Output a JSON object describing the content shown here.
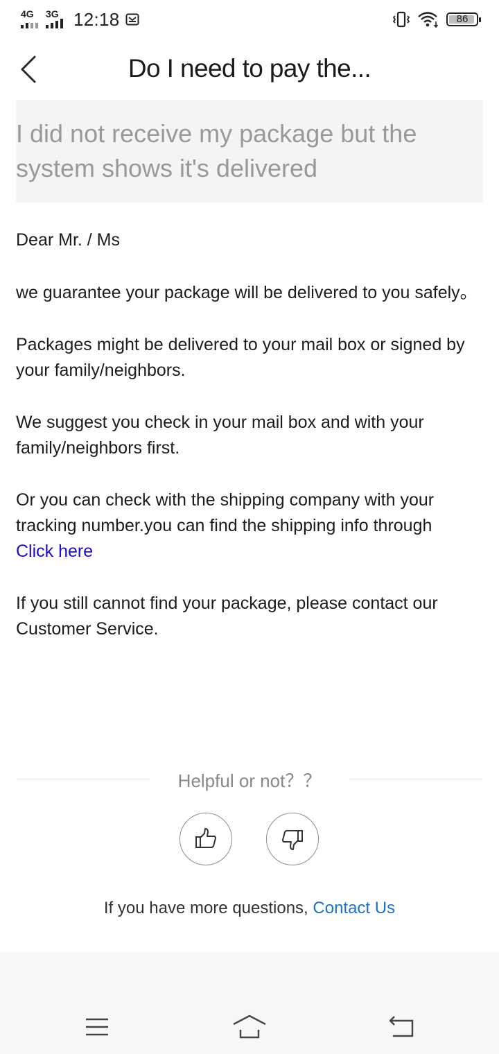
{
  "status_bar": {
    "network_1": "4G",
    "network_2": "3G",
    "time": "12:18",
    "battery_level": "86",
    "icons": [
      "signal-4g-icon",
      "signal-3g-icon",
      "mail-notification-icon",
      "vibrate-icon",
      "wifi-icon",
      "battery-icon"
    ]
  },
  "header": {
    "title": "Do I need to pay the...",
    "back_icon": "chevron-left-icon"
  },
  "question": "I did not receive my package but the system shows it's delivered",
  "article": {
    "greeting": "Dear Mr. / Ms",
    "p1": "we guarantee  your package will be delivered to you safely。",
    "p2": "Packages might be delivered to your mail box or signed by your family/neighbors.",
    "p3": "We suggest you check in your mail box and with your family/neighbors first.",
    "p4": "Or you can check with the shipping company with your tracking number.you can find the shipping info through",
    "p4_link": "Click here",
    "p5": "If you still cannot find your package, please contact our Customer Service."
  },
  "feedback": {
    "label": "Helpful or not？？",
    "up_icon": "thumbs-up-icon",
    "down_icon": "thumbs-down-icon"
  },
  "contact": {
    "prefix": "If you have more questions, ",
    "link": "Contact Us"
  },
  "nav": {
    "icons": [
      "menu-icon",
      "home-icon",
      "back-icon"
    ]
  },
  "colors": {
    "link_blue": "#1a0dcc",
    "contact_blue": "#1a73c8",
    "question_bg": "#f4f4f4",
    "question_text": "#999999"
  }
}
